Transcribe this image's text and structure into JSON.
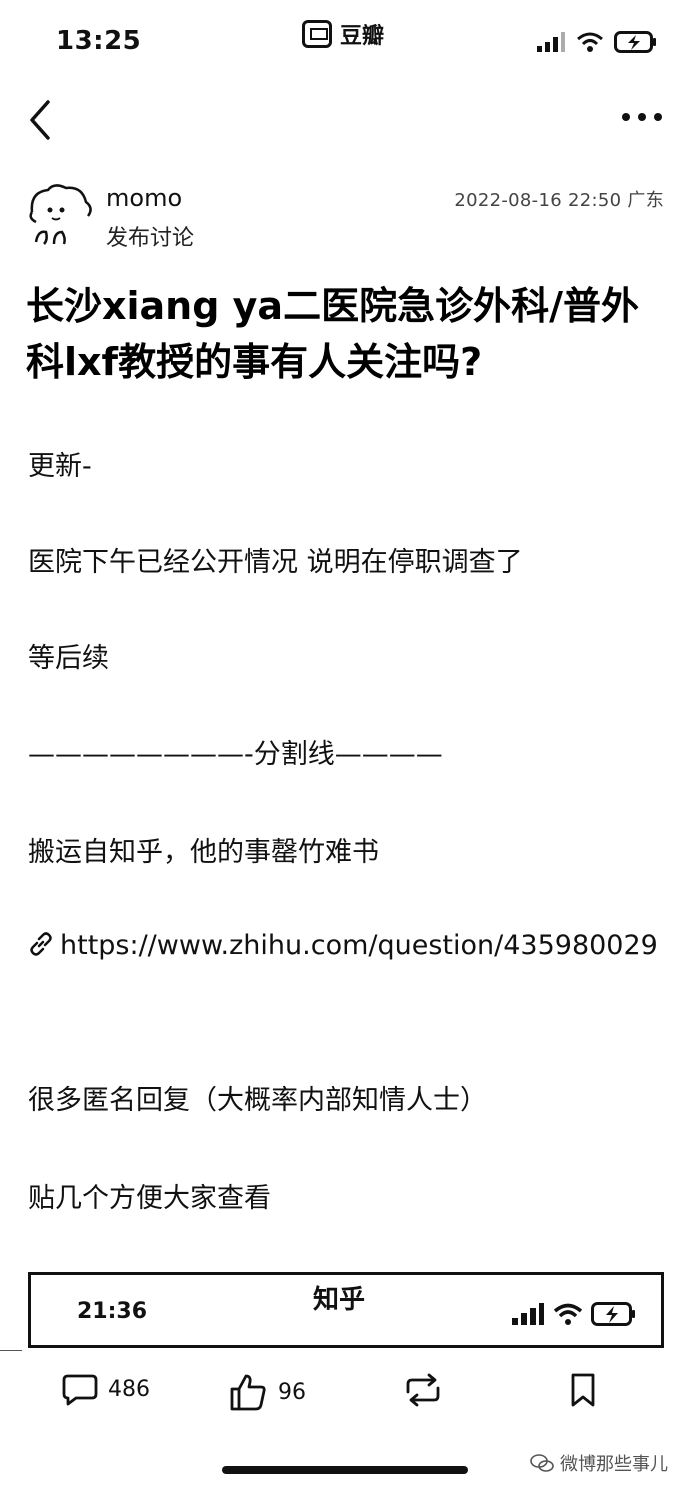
{
  "status_bar": {
    "time": "13:25",
    "app_name": "豆瓣",
    "icons": [
      "signal-icon",
      "wifi-icon",
      "battery-charging-icon"
    ]
  },
  "nav": {
    "back_icon": "chevron-left-icon",
    "more_icon": "more-horizontal-icon"
  },
  "author": {
    "name": "momo",
    "action": "发布讨论",
    "date": "2022-08-16 22:50 广东"
  },
  "post": {
    "title": "长沙xiang ya二医院急诊外科/普外科lxf教授的事有人关注吗?",
    "update_label": "更新-",
    "line_hospital": "医院下午已经公开情况 说明在停职调查了",
    "line_wait": "等后续",
    "divider_prefix": "————————-",
    "divider_label": "分割线",
    "divider_suffix": "————",
    "line_source": "搬运自知乎，他的事罄竹难书",
    "link_icon": "link-icon",
    "link_url": "https://www.zhihu.com/question/435980029",
    "line_anonymous": "很多匿名回复（大概率内部知情人士）",
    "line_post_some": "贴几个方便大家查看"
  },
  "embed": {
    "time": "21:36",
    "title": "知乎"
  },
  "actions": {
    "comment_count": "486",
    "like_count": "96"
  },
  "watermark": {
    "text": "微博那些事儿"
  }
}
